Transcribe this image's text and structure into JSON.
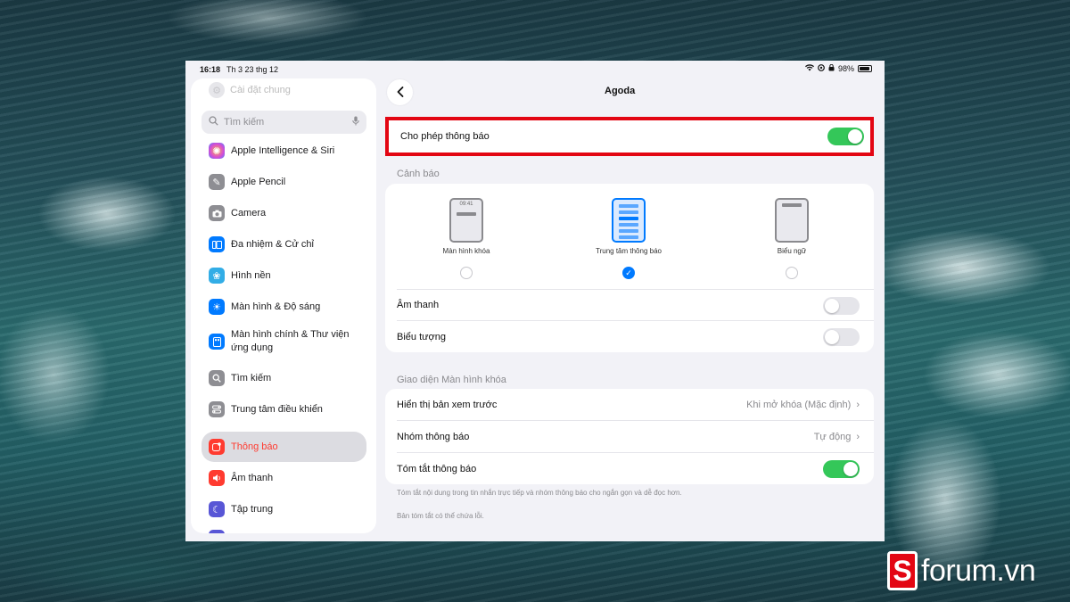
{
  "status_bar": {
    "time": "16:18",
    "date": "Th 3 23 thg 12",
    "battery": "98%"
  },
  "sidebar": {
    "faded_item": "Cài đặt chung",
    "search_placeholder": "Tìm kiếm",
    "items": [
      {
        "label": "Apple Intelligence & Siri",
        "icon": "siri-icon",
        "color": "#d44bd6"
      },
      {
        "label": "Apple Pencil",
        "icon": "pencil-icon",
        "color": "#8e8e93"
      },
      {
        "label": "Camera",
        "icon": "camera-icon",
        "color": "#8e8e93"
      },
      {
        "label": "Đa nhiệm & Cử chỉ",
        "icon": "multitasking-icon",
        "color": "#007aff"
      },
      {
        "label": "Hình nền",
        "icon": "wallpaper-icon",
        "color": "#32ade6"
      },
      {
        "label": "Màn hình & Độ sáng",
        "icon": "brightness-icon",
        "color": "#007aff"
      },
      {
        "label": "Màn hình chính & Thư viện ứng dụng",
        "icon": "home-screen-icon",
        "color": "#007aff"
      },
      {
        "label": "Tìm kiếm",
        "icon": "search-icon",
        "color": "#8e8e93"
      },
      {
        "label": "Trung tâm điều khiển",
        "icon": "control-center-icon",
        "color": "#8e8e93"
      },
      {
        "label": "Thông báo",
        "icon": "notifications-icon",
        "color": "#ff3b30",
        "active": true
      },
      {
        "label": "Âm thanh",
        "icon": "sound-icon",
        "color": "#ff3b30"
      },
      {
        "label": "Tập trung",
        "icon": "focus-icon",
        "color": "#5856d6"
      }
    ]
  },
  "detail": {
    "title": "Agoda",
    "allow_notifications": {
      "label": "Cho phép thông báo",
      "on": true
    },
    "alerts_header": "Cảnh báo",
    "alert_styles": [
      {
        "label": "Màn hình khóa",
        "selected": false,
        "time": "09:41"
      },
      {
        "label": "Trung tâm thông báo",
        "selected": true
      },
      {
        "label": "Biểu ngữ",
        "selected": false
      }
    ],
    "sounds": {
      "label": "Âm thanh",
      "on": false
    },
    "badges": {
      "label": "Biểu tượng",
      "on": false
    },
    "lock_screen_header": "Giao diện Màn hình khóa",
    "show_previews": {
      "label": "Hiển thị bản xem trước",
      "value": "Khi mở khóa (Mặc định)"
    },
    "grouping": {
      "label": "Nhóm thông báo",
      "value": "Tự động"
    },
    "summarize": {
      "label": "Tóm tắt thông báo",
      "on": true
    },
    "footnote_1": "Tóm tắt nội dung trong tin nhắn trực tiếp và nhóm thông báo cho ngắn gọn và dễ đọc hơn.",
    "footnote_2": "Bản tóm tắt có thể chứa lỗi."
  },
  "watermark": {
    "logo_letter": "S",
    "text": "forum.vn"
  },
  "colors": {
    "accent": "#007aff",
    "toggle_on": "#34c759",
    "highlight": "#e30613"
  }
}
